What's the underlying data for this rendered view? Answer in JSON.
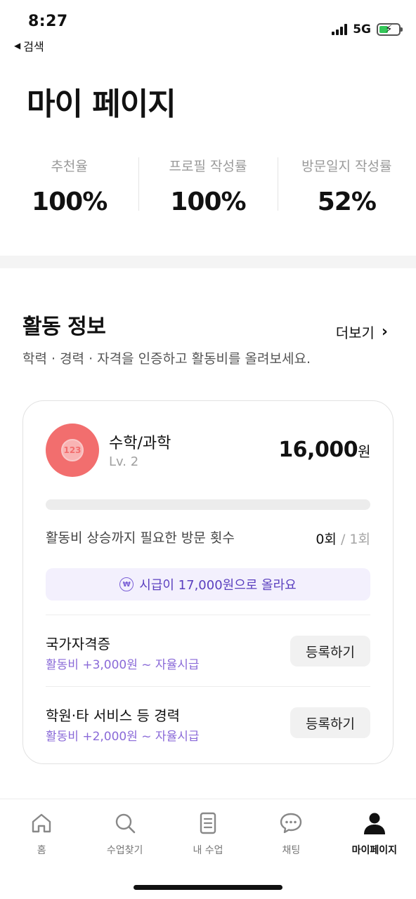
{
  "status_bar": {
    "time": "8:27",
    "back_label": "검색",
    "network": "5G",
    "battery_level": 0.45
  },
  "page": {
    "title": "마이 페이지"
  },
  "stats": [
    {
      "label": "추천율",
      "value": "100%"
    },
    {
      "label": "프로필 작성률",
      "value": "100%"
    },
    {
      "label": "방문일지 작성률",
      "value": "52%"
    }
  ],
  "activity": {
    "title": "활동 정보",
    "more_label": "더보기",
    "description": "학력 · 경력 · 자격을 인증하고 활동비를 올려보세요.",
    "card": {
      "subject_icon_text": "123",
      "subject": "수학/과학",
      "level": "Lv. 2",
      "wage": "16,000",
      "wage_unit": "원",
      "progress": 0,
      "visits_label": "활동비 상승까지 필요한 방문 횟수",
      "visits_done": "0회",
      "visits_sep": "/",
      "visits_total": "1회",
      "raise_message": "시급이 17,000원으로 올라요",
      "items": [
        {
          "title": "국가자격증",
          "sub": "활동비 +3,000원 ~ 자율시급",
          "button": "등록하기"
        },
        {
          "title": "학원·타 서비스 등 경력",
          "sub": "활동비 +2,000원 ~ 자율시급",
          "button": "등록하기"
        }
      ]
    }
  },
  "tabbar": {
    "items": [
      {
        "label": "홈",
        "icon": "home-icon"
      },
      {
        "label": "수업찾기",
        "icon": "search-icon"
      },
      {
        "label": "내 수업",
        "icon": "document-icon"
      },
      {
        "label": "채팅",
        "icon": "chat-icon"
      },
      {
        "label": "마이페이지",
        "icon": "person-icon",
        "active": true
      }
    ]
  },
  "colors": {
    "accent_purple": "#5a3fbf",
    "subject_red": "#f26e6e",
    "battery_green": "#34c759"
  }
}
